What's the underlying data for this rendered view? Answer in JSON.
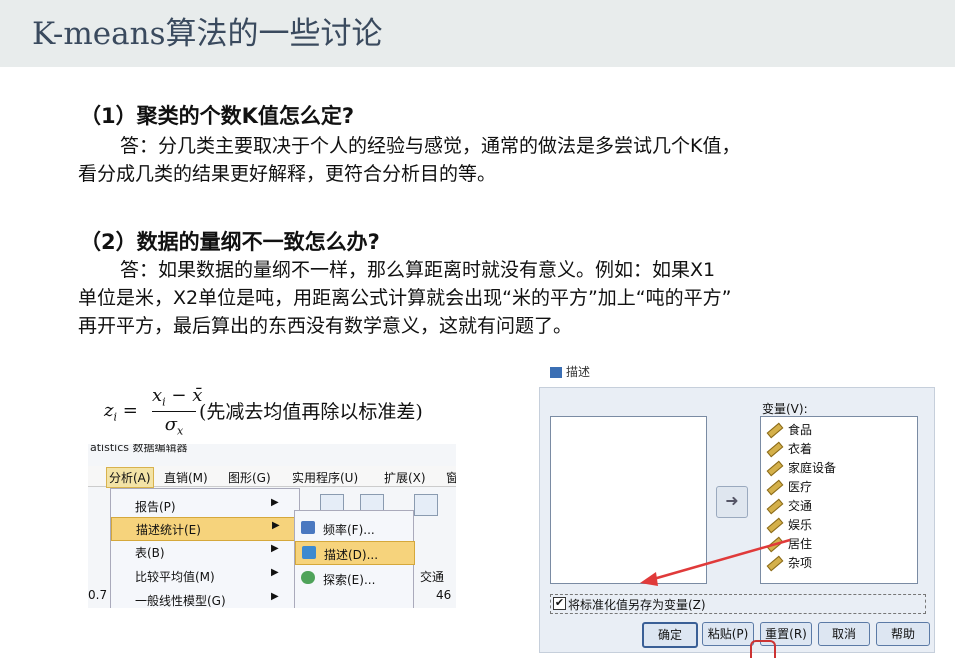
{
  "slide_title": "K-means算法的一些讨论",
  "q1": {
    "heading": "（1）聚类的个数K值怎么定?",
    "answer_line1": "答：分几类主要取决于个人的经验与感觉，通常的做法是多尝试几个K值，",
    "answer_line2": "看分成几类的结果更好解释，更符合分析目的等。"
  },
  "q2": {
    "heading": "（2）数据的量纲不一致怎么办?",
    "answer_line1": "答：如果数据的量纲不一样，那么算距离时就没有意义。例如：如果X1",
    "answer_line2": "单位是米，X2单位是吨，用距离公式计算就会出现“米的平方”加上“吨的平方”",
    "answer_line3": "再开平方，最后算出的东西没有数学意义，这就有问题了。"
  },
  "formula": {
    "lhs": "z",
    "lhs_sub": "i",
    "numerator": "x",
    "numerator_sub": "i",
    "minus": "−",
    "mean": "x̄",
    "denominator": "σ",
    "denominator_sub": "x",
    "note": "(先减去均值再除以标准差)"
  },
  "spss_menu": {
    "caption": "atistics 数据编辑器",
    "menubar": [
      "分析(A)",
      "直销(M)",
      "图形(G)",
      "实用程序(U)",
      "扩展(X)",
      "窗"
    ],
    "analyze_items": [
      {
        "label": "报告(P)"
      },
      {
        "label": "描述统计(E)"
      },
      {
        "label": "表(B)"
      },
      {
        "label": "比较平均值(M)"
      },
      {
        "label": "一般线性模型(G)"
      }
    ],
    "submenu_items": [
      {
        "label": "频率(F)..."
      },
      {
        "label": "描述(D)..."
      },
      {
        "label": "探索(E)..."
      }
    ],
    "grid_header": "交通",
    "grid_value": "46",
    "grid_left_value": "0.7"
  },
  "dialog": {
    "title": "描述",
    "variables_label": "变量(V):",
    "variables": [
      "食品",
      "衣着",
      "家庭设备",
      "医疗",
      "交通",
      "娱乐",
      "居住",
      "杂项"
    ],
    "checkbox_label": "将标准化值另存为变量(Z)",
    "checkbox_checked": "✔",
    "buttons": [
      "确定",
      "粘贴(P)",
      "重置(R)",
      "取消",
      "帮助"
    ]
  },
  "colors": {
    "title_bg": "#e8ecec",
    "title_text": "#3a4a5e",
    "menu_highlight": "#f6d37c",
    "annotation_arrow": "#e03a3a"
  }
}
